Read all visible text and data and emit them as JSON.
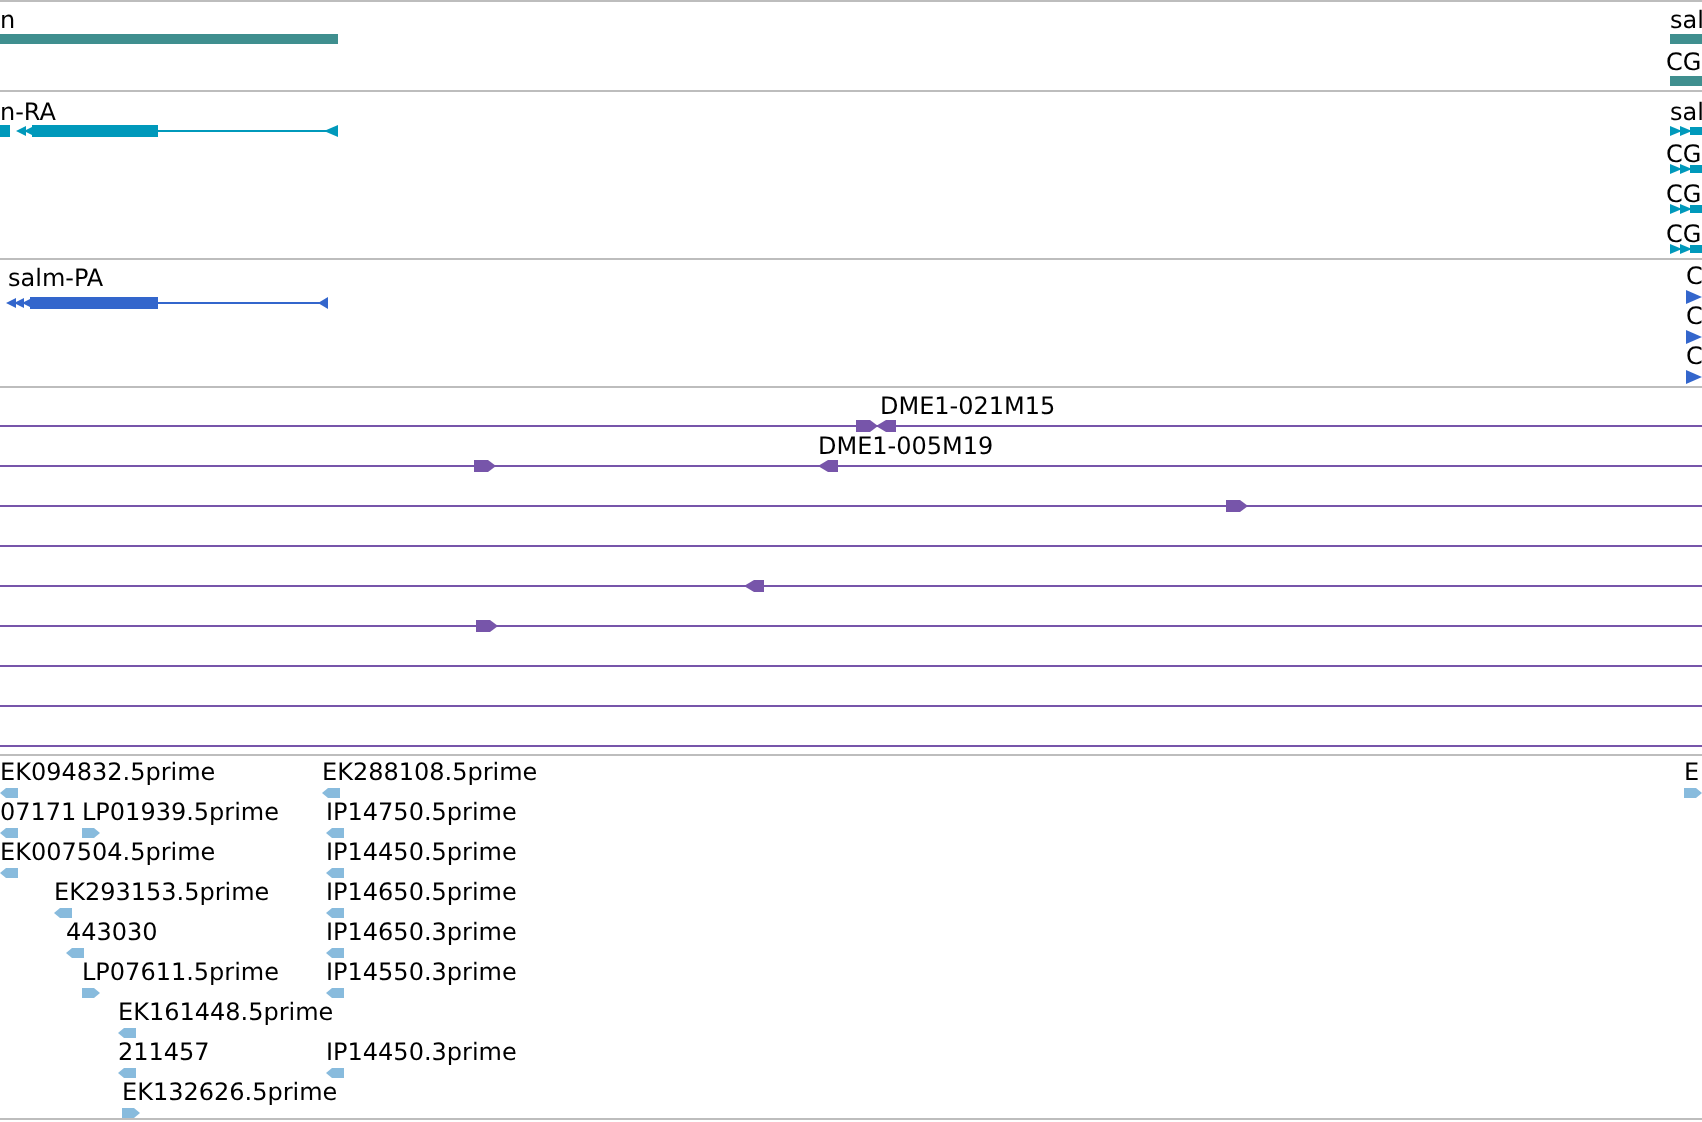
{
  "tracks": [
    {
      "kind": "gene",
      "features": [
        {
          "label": "n"
        },
        {
          "label": "sal"
        },
        {
          "label": "CG"
        }
      ]
    },
    {
      "kind": "transcript",
      "features": [
        {
          "label": "n-RA"
        },
        {
          "label": "sal"
        },
        {
          "label": "CG"
        },
        {
          "label": "CG"
        },
        {
          "label": "CG"
        }
      ]
    },
    {
      "kind": "protein",
      "features": [
        {
          "label": "salm-PA"
        },
        {
          "label": "C"
        },
        {
          "label": "C"
        },
        {
          "label": "C"
        }
      ]
    },
    {
      "kind": "clone",
      "features": [
        {
          "label": "DME1-021M15"
        },
        {
          "label": "DME1-005M19"
        }
      ]
    },
    {
      "kind": "est",
      "features": [
        {
          "label": "EK094832.5prime",
          "forward": false
        },
        {
          "label": "EK288108.5prime",
          "forward": false
        },
        {
          "label": "07171",
          "forward": false
        },
        {
          "label": "LP01939.5prime",
          "forward": true
        },
        {
          "label": "IP14750.5prime",
          "forward": false
        },
        {
          "label": "EK007504.5prime",
          "forward": false
        },
        {
          "label": "IP14450.5prime",
          "forward": false
        },
        {
          "label": "EK293153.5prime",
          "forward": false
        },
        {
          "label": "IP14650.5prime",
          "forward": false
        },
        {
          "label": "443030",
          "forward": false
        },
        {
          "label": "IP14650.3prime",
          "forward": false
        },
        {
          "label": "LP07611.5prime",
          "forward": true
        },
        {
          "label": "IP14550.3prime",
          "forward": false
        },
        {
          "label": "EK161448.5prime",
          "forward": false
        },
        {
          "label": "211457",
          "forward": false
        },
        {
          "label": "IP14450.3prime",
          "forward": false
        },
        {
          "label": "EK132626.5prime",
          "forward": true
        },
        {
          "label": "E",
          "forward": true
        }
      ]
    }
  ]
}
